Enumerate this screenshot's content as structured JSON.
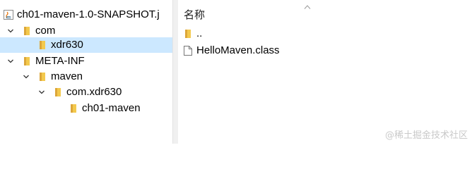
{
  "tree": {
    "root_label": "ch01-maven-1.0-SNAPSHOT.j",
    "items": [
      {
        "label": "com"
      },
      {
        "label": "xdr630"
      },
      {
        "label": "META-INF"
      },
      {
        "label": "maven"
      },
      {
        "label": "com.xdr630"
      },
      {
        "label": "ch01-maven"
      }
    ]
  },
  "list": {
    "column_name": "名称",
    "items": [
      {
        "label": ".."
      },
      {
        "label": "HelloMaven.class"
      }
    ]
  },
  "watermark": "@稀土掘金技术社区",
  "colors": {
    "selection": "#cce8ff",
    "folder": "#f3c94d",
    "folder_dark": "#dca63a"
  }
}
